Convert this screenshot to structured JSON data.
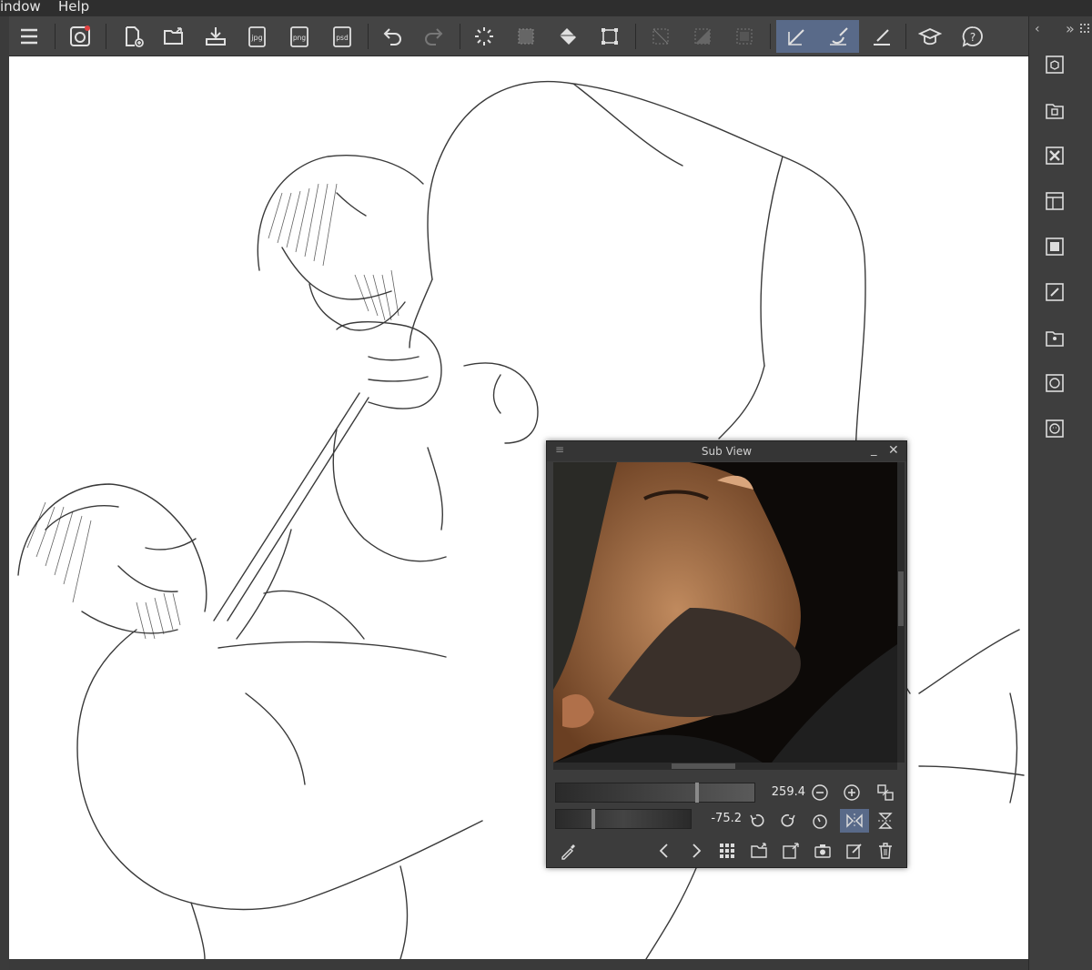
{
  "menubar": {
    "items": [
      "indow",
      "Help"
    ]
  },
  "toolbar": {
    "buttons": [
      {
        "name": "menu-icon"
      },
      {
        "name": "clip-studio-icon"
      },
      {
        "name": "new-file-icon"
      },
      {
        "name": "open-file-icon"
      },
      {
        "name": "save-icon"
      },
      {
        "name": "export-jpg-icon",
        "label": "jpg"
      },
      {
        "name": "export-png-icon",
        "label": "png"
      },
      {
        "name": "export-psd-icon",
        "label": "psd"
      },
      {
        "name": "undo-icon"
      },
      {
        "name": "redo-icon"
      },
      {
        "name": "loading-icon"
      },
      {
        "name": "select-all-icon"
      },
      {
        "name": "fill-icon"
      },
      {
        "name": "transform-icon"
      },
      {
        "name": "deselect-icon"
      },
      {
        "name": "invert-selection-icon"
      },
      {
        "name": "show-selection-icon"
      },
      {
        "name": "pen-snap-icon"
      },
      {
        "name": "brush-snap-icon"
      },
      {
        "name": "ruler-snap-icon"
      },
      {
        "name": "tutorial-icon"
      },
      {
        "name": "help-icon"
      }
    ]
  },
  "rightpanel": {
    "arrows_left": "‹",
    "arrows_right": "»",
    "items": [
      "3d-material-icon",
      "material-folder-icon",
      "close-panel-icon",
      "layout-icon",
      "image-material-icon",
      "edit-icon",
      "character-icon",
      "face-icon",
      "face-alt-icon"
    ]
  },
  "subview": {
    "title": "Sub View",
    "zoom": "259.4",
    "rotation": "-75.2",
    "zoom_slider_fraction": 0.71,
    "rotation_slider_fraction": 0.28
  },
  "colors": {
    "chrome": "#444444",
    "canvas": "#ffffff",
    "active": "#596a89"
  }
}
